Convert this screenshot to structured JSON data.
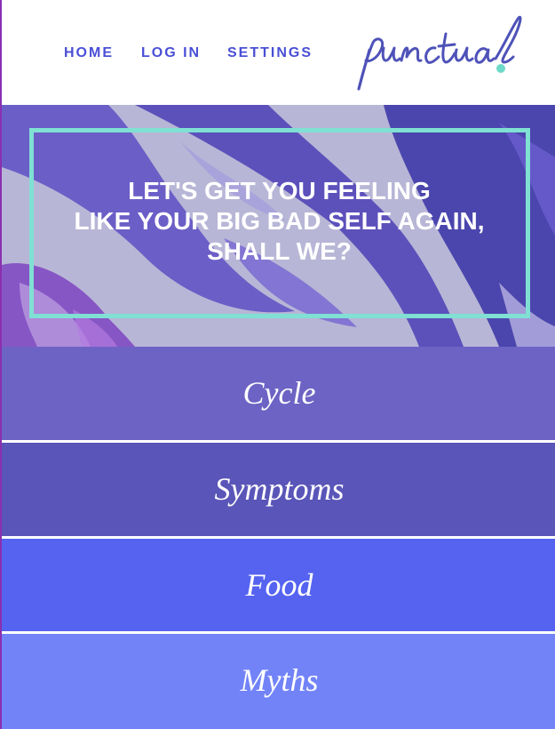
{
  "nav": {
    "home": "HOME",
    "login": "LOG IN",
    "settings": "SETTINGS"
  },
  "logo": {
    "text": "punctual.",
    "icon": "punctual-wordmark-logo"
  },
  "hero": {
    "lines": [
      "LET'S GET YOU FEELING",
      "LIKE YOUR BIG BAD SELF AGAIN,",
      "SHALL WE?"
    ]
  },
  "categories": [
    {
      "label": "Cycle",
      "color": "#6d63c4"
    },
    {
      "label": "Symptoms",
      "color": "#5a55b8"
    },
    {
      "label": "Food",
      "color": "#5563f0"
    },
    {
      "label": "Myths",
      "color": "#7283f7"
    }
  ],
  "colors": {
    "nav_text": "#4a4fd6",
    "frame": "#7fe0d3",
    "logo_dot": "#6fd9c8",
    "logo_ink": "#4e52b8"
  }
}
